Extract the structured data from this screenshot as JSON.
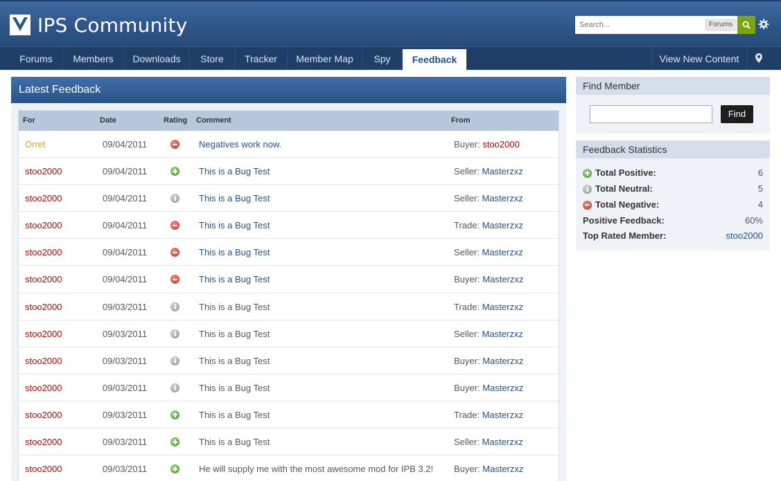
{
  "header": {
    "site_title": "IPS Community",
    "search_placeholder": "Search...",
    "search_scope": "Forums"
  },
  "nav": {
    "items": [
      "Forums",
      "Members",
      "Downloads",
      "Store",
      "Tracker",
      "Member Map",
      "Spy",
      "Feedback"
    ],
    "active": "Feedback",
    "right_item": "View New Content"
  },
  "main": {
    "title": "Latest Feedback",
    "columns": [
      "For",
      "Date",
      "Rating",
      "Comment",
      "From"
    ],
    "rows": [
      {
        "for": "Orret",
        "date": "09/04/2011",
        "rating": "negative",
        "comment": "Negatives work now.",
        "from_role": "Buyer:",
        "from_name": "stoo2000"
      },
      {
        "for": "stoo2000",
        "date": "09/04/2011",
        "rating": "positive",
        "comment": "This is a Bug Test",
        "from_role": "Seller:",
        "from_name": "Masterzxz"
      },
      {
        "for": "stoo2000",
        "date": "09/04/2011",
        "rating": "neutral",
        "comment": "This is a Bug Test",
        "from_role": "Seller:",
        "from_name": "Masterzxz"
      },
      {
        "for": "stoo2000",
        "date": "09/04/2011",
        "rating": "negative",
        "comment": "This is a Bug Test",
        "from_role": "Trade:",
        "from_name": "Masterzxz"
      },
      {
        "for": "stoo2000",
        "date": "09/04/2011",
        "rating": "negative",
        "comment": "This is a Bug Test",
        "from_role": "Seller:",
        "from_name": "Masterzxz"
      },
      {
        "for": "stoo2000",
        "date": "09/04/2011",
        "rating": "negative",
        "comment": "This is a Bug Test",
        "from_role": "Buyer:",
        "from_name": "Masterzxz"
      },
      {
        "for": "stoo2000",
        "date": "09/03/2011",
        "rating": "neutral",
        "comment": "This is a Bug Test",
        "from_role": "Trade:",
        "from_name": "Masterzxz"
      },
      {
        "for": "stoo2000",
        "date": "09/03/2011",
        "rating": "neutral",
        "comment": "This is a Bug Test",
        "from_role": "Seller:",
        "from_name": "Masterzxz"
      },
      {
        "for": "stoo2000",
        "date": "09/03/2011",
        "rating": "neutral",
        "comment": "This is a Bug Test",
        "from_role": "Buyer:",
        "from_name": "Masterzxz"
      },
      {
        "for": "stoo2000",
        "date": "09/03/2011",
        "rating": "neutral",
        "comment": "This is a Bug Test",
        "from_role": "Buyer:",
        "from_name": "Masterzxz"
      },
      {
        "for": "stoo2000",
        "date": "09/03/2011",
        "rating": "positive",
        "comment": "This is a Bug Test",
        "from_role": "Trade:",
        "from_name": "Masterzxz"
      },
      {
        "for": "stoo2000",
        "date": "09/03/2011",
        "rating": "positive",
        "comment": "This is a Bug Test",
        "from_role": "Seller:",
        "from_name": "Masterzxz"
      },
      {
        "for": "stoo2000",
        "date": "09/03/2011",
        "rating": "positive",
        "comment": "He will supply me with the most awesome mod for IPB 3.2!",
        "from_role": "Buyer:",
        "from_name": "Masterzxz"
      }
    ]
  },
  "sidebar": {
    "find_member": {
      "title": "Find Member",
      "button": "Find",
      "value": ""
    },
    "stats": {
      "title": "Feedback Statistics",
      "total_positive_label": "Total Positive:",
      "total_positive": "6",
      "total_neutral_label": "Total Neutral:",
      "total_neutral": "5",
      "total_negative_label": "Total Negative:",
      "total_negative": "4",
      "positive_feedback_label": "Positive Feedback:",
      "positive_feedback": "60%",
      "top_rated_label": "Top Rated Member:",
      "top_rated": "stoo2000"
    }
  },
  "colors": {
    "header_blue": "#2d5587",
    "nav_dark": "#1f3f69",
    "name_red": "#b30000",
    "name_orange": "#e0a020",
    "link_blue": "#244f86",
    "search_green": "#7ba60d"
  }
}
